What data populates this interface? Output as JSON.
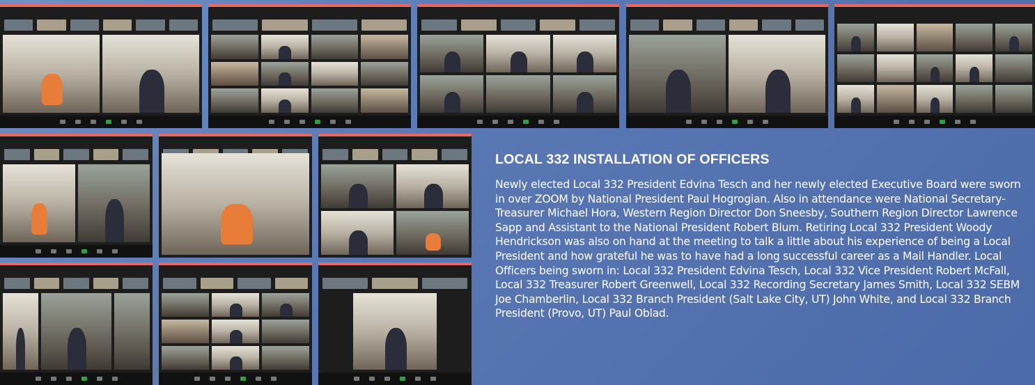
{
  "article": {
    "heading": "LOCAL 332 INSTALLATION OF OFFICERS",
    "body": "Newly elected Local 332 President Edvina Tesch and her newly elected Executive Board were sworn in over ZOOM by National President Paul Hogrogian. Also in attendance were National Secretary-Treasurer Michael Hora, Western Region Director Don Sneesby, Southern Region Director Lawrence Sapp and Assistant to the National President Robert Blum. Retiring Local 332 President Woody Hendrickson was also on hand at the meeting to talk a little about his experience of being a Local President and how grateful he was to have had a long successful career as a Mail Handler. Local Officers being sworn in: Local 332 President Edvina Tesch, Local 332 Vice President Robert McFall, Local 332 Treasurer Robert Greenwell, Local 332 Recording Secretary James Smith, Local 332 SEBM Joe Chamberlin, Local 332 Branch President (Salt Lake City, UT) John White, and Local 332 Branch President (Provo, UT) Paul Oblad."
  },
  "colors": {
    "page_background": "#5f7fbc",
    "window_titlebar": "#e46a63",
    "window_body": "#1d1d1d",
    "heading_text": "#ffffff",
    "body_text": "#ffffff"
  },
  "screenshots": [
    {
      "id": "zoom-1",
      "layout": "two-speaker"
    },
    {
      "id": "zoom-2",
      "layout": "gallery-3x3"
    },
    {
      "id": "zoom-3",
      "layout": "gallery-2x3"
    },
    {
      "id": "zoom-4",
      "layout": "two-speaker"
    },
    {
      "id": "zoom-5",
      "layout": "gallery-3x5"
    },
    {
      "id": "zoom-6",
      "layout": "two-speaker"
    },
    {
      "id": "zoom-7",
      "layout": "single-speaker"
    },
    {
      "id": "zoom-8",
      "layout": "gallery-2x2"
    },
    {
      "id": "zoom-9",
      "layout": "gallery-2x3"
    },
    {
      "id": "zoom-10",
      "layout": "gallery-3x3"
    },
    {
      "id": "zoom-11",
      "layout": "single-speaker"
    }
  ]
}
